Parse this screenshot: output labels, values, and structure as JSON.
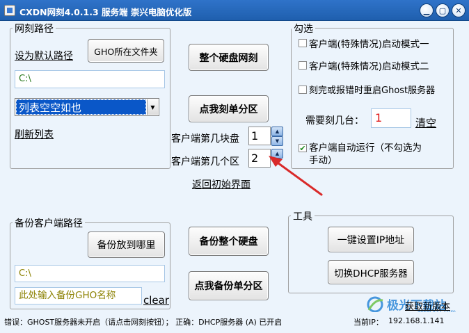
{
  "window": {
    "title": "CXDN网刻4.0.1.3 服务端  崇兴电脑优化版",
    "minimize": "▁",
    "maximize": "▢",
    "close": "✕"
  },
  "path_panel": {
    "title": "网刻路径",
    "set_default_link": "设为默认路径",
    "gho_folder_button": "GHO所在文件夹",
    "path_value": "C:\\",
    "list_selected": "列表空空如也",
    "refresh_link": "刷新列表"
  },
  "center": {
    "whole_disk_button": "整个硬盘网刻",
    "single_partition_button": "点我刻单分区",
    "disk_label": "客户端第几块盘",
    "disk_value": "1",
    "partition_label": "客户端第几个区",
    "partition_value": "2",
    "return_link": "返回初始界面",
    "backup_disk_button": "备份整个硬盘",
    "backup_partition_button": "点我备份单分区"
  },
  "options_panel": {
    "title": "勾选",
    "option1": "客户端(特殊情况)启动模式一",
    "option2": "客户端(特殊情况)启动模式二",
    "option3": "刻完或报错时重启Ghost服务器",
    "count_label": "需要刻几台：",
    "count_value": "1",
    "clear_link": "清空",
    "autorun_line1": "客户端自动运行（不勾选为",
    "autorun_line2": "手动）",
    "autorun_checked": true
  },
  "backup_panel": {
    "title": "备份客户端路径",
    "where_button": "备份放到哪里",
    "path_value": "C:\\",
    "name_placeholder": "此处输入备份GHO名称",
    "clear_link": "clear"
  },
  "tools_panel": {
    "title": "工具",
    "set_ip_button": "一键设置IP地址",
    "switch_dhcp_button": "切换DHCP服务器"
  },
  "status": {
    "error_text": "错误：GHOST服务器未开启（请点击网刻按钮）；  正确：DHCP服务器 (A) 已开启",
    "ip_label": "当前IP：",
    "ip_value": "192.168.1.141",
    "update_link": "获取新版本"
  },
  "watermark": {
    "site": "极光下载站",
    "url": "www.xz7.com"
  },
  "colors": {
    "titlebar": "#2467bb",
    "background": "#ecf4fc",
    "path_text": "#2c7b20",
    "selected_item_bg": "#0a57c8",
    "count_value": "#e01818",
    "arrow": "#d92a2a"
  }
}
